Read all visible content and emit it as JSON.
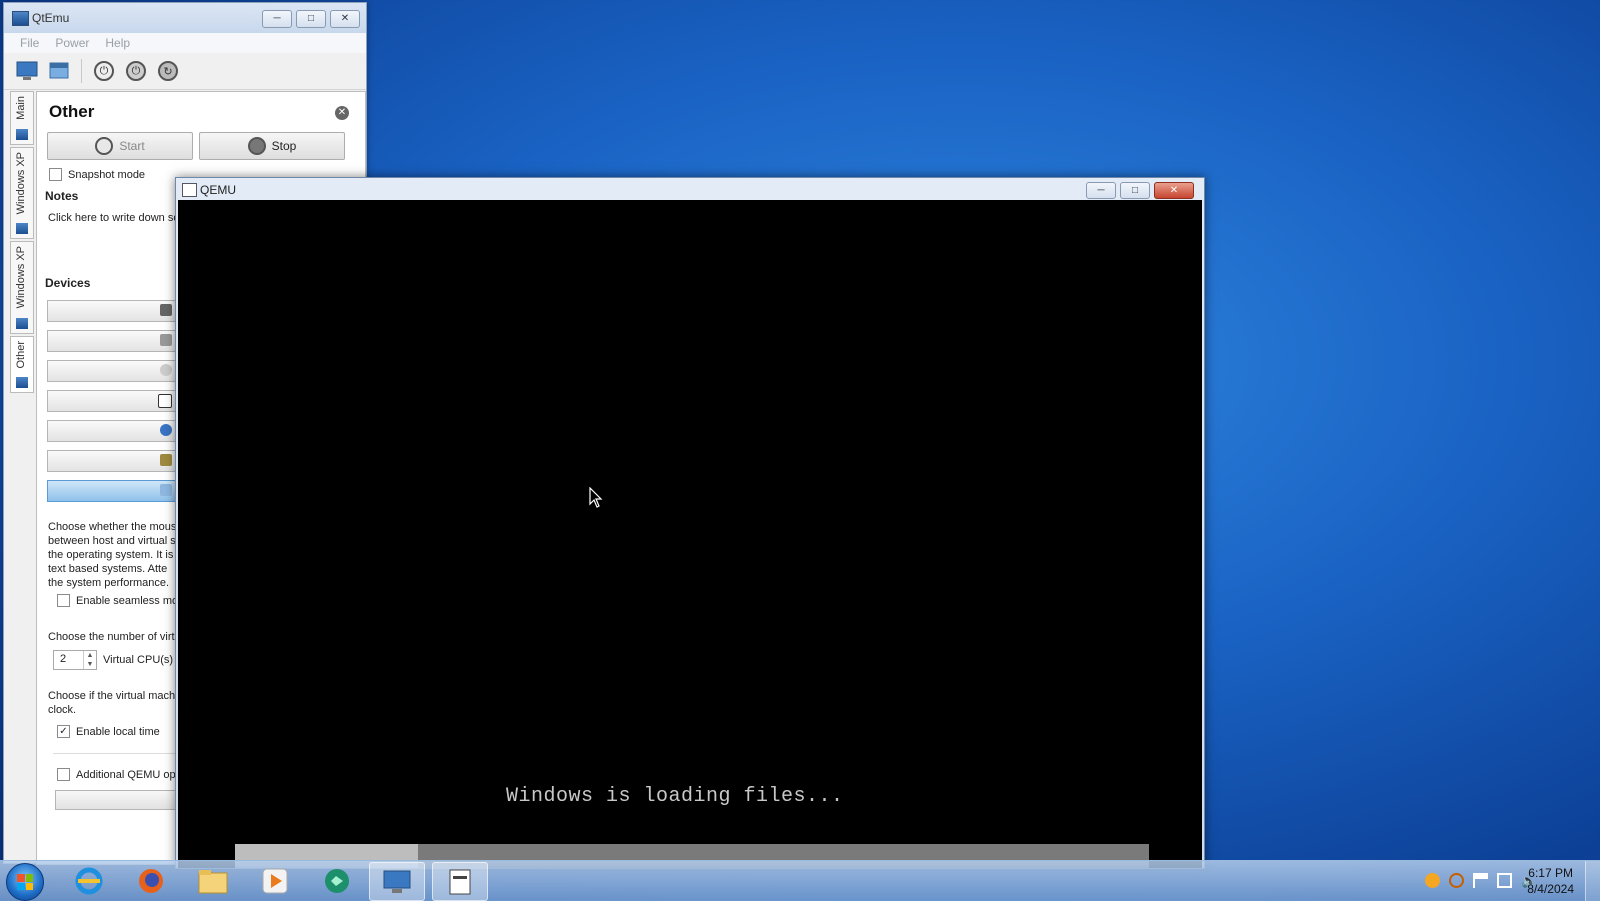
{
  "qtemu": {
    "title": "QtEmu",
    "menu": [
      "File",
      "Power",
      "Help"
    ],
    "side_tabs": [
      "Main",
      "Windows XP",
      "Windows XP",
      "Other"
    ],
    "panel": {
      "title": "Other",
      "start_label": "Start",
      "stop_label": "Stop",
      "snapshot_label": "Snapshot mode",
      "notes_heading": "Notes",
      "notes_placeholder": "Click here to write down so",
      "devices_heading": "Devices",
      "mouse_description": [
        "Choose whether the mous",
        "between host and virtual s",
        "the operating system. It is",
        "text based systems. Atte",
        "the system performance."
      ],
      "seamless_mouse_label": "Enable seamless mous",
      "cpu_description": "Choose the number of virt",
      "cpu_count": "2",
      "cpu_label": "Virtual CPU(s)",
      "clock_description": [
        "Choose if the virtual mach",
        "clock."
      ],
      "local_time_label": "Enable local time",
      "local_time_checked": true,
      "additional_options_label": "Additional QEMU optio"
    }
  },
  "qemu": {
    "title": "QEMU",
    "loading_text": "Windows is loading files...",
    "progress": 0.2
  },
  "taskbar": {
    "apps": [
      "internet-explorer-icon",
      "firefox-icon",
      "file-explorer-icon",
      "media-player-icon",
      "chat-app-icon",
      "qtemu-icon",
      "qemu-window-icon"
    ],
    "time": "6:17 PM",
    "date": "8/4/2024"
  }
}
